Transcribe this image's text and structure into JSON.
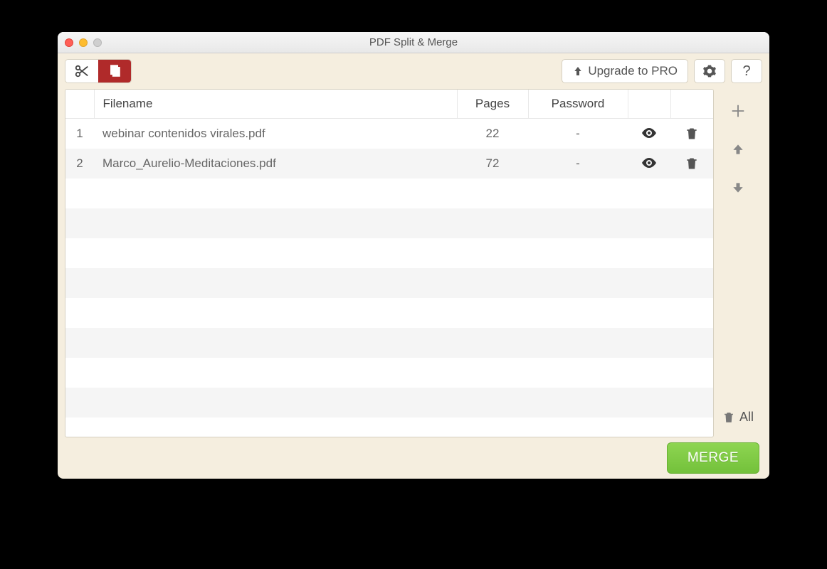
{
  "window_title": "PDF Split & Merge",
  "toolbar": {
    "upgrade_label": "Upgrade to PRO"
  },
  "columns": {
    "filename": "Filename",
    "pages": "Pages",
    "password": "Password"
  },
  "files": [
    {
      "index": "1",
      "name": "webinar contenidos virales.pdf",
      "pages": "22",
      "password": "-"
    },
    {
      "index": "2",
      "name": "Marco_Aurelio-Meditaciones.pdf",
      "pages": "72",
      "password": "-"
    }
  ],
  "side": {
    "delete_all_label": "All"
  },
  "actions": {
    "merge_label": "MERGE"
  },
  "help_label": "?"
}
